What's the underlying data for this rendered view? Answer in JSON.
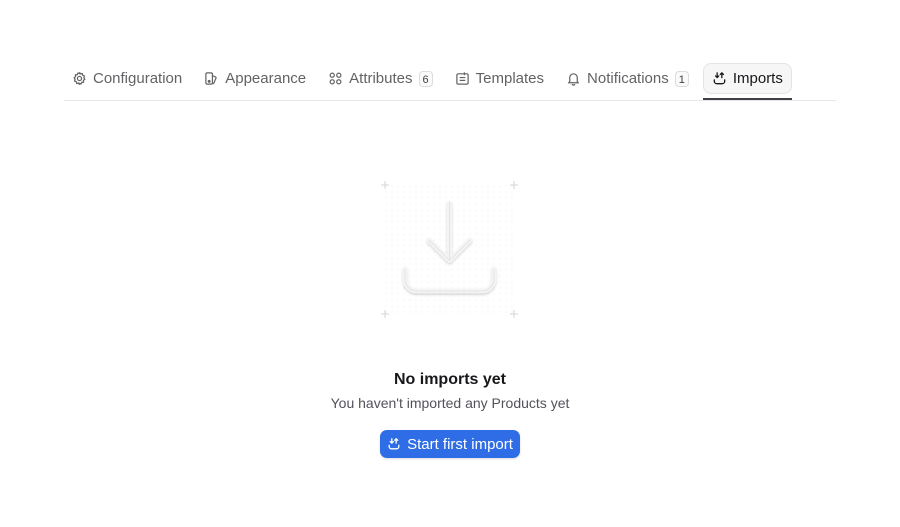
{
  "tabs": [
    {
      "label": "Configuration",
      "icon": "gear-icon"
    },
    {
      "label": "Appearance",
      "icon": "palette-icon"
    },
    {
      "label": "Attributes",
      "icon": "grid-icon",
      "badge": "6"
    },
    {
      "label": "Templates",
      "icon": "template-icon"
    },
    {
      "label": "Notifications",
      "icon": "bell-icon",
      "badge": "1"
    },
    {
      "label": "Imports",
      "icon": "import-icon",
      "active": true
    }
  ],
  "empty_state": {
    "illustration_icon": "download-icon",
    "title": "No imports yet",
    "subtitle": "You haven't imported any Products yet",
    "button_label": "Start first import",
    "button_icon": "import-icon"
  },
  "colors": {
    "accent": "#2e6de6",
    "active_tab_underline": "#3f3f46",
    "text_muted": "#636366"
  }
}
